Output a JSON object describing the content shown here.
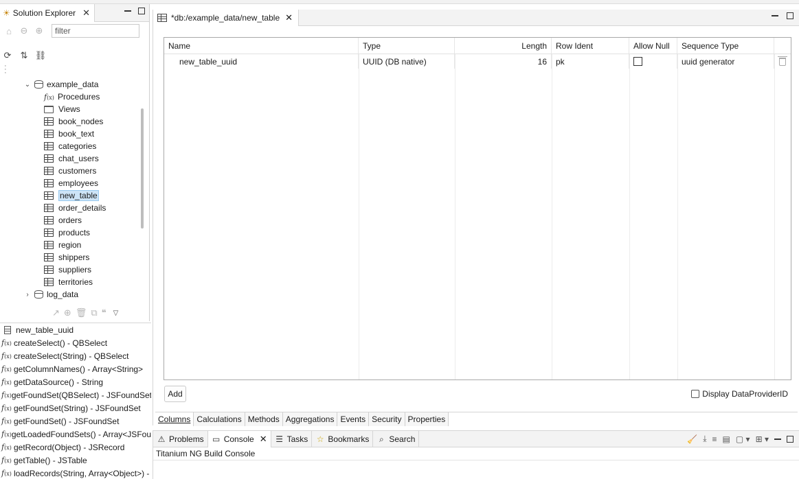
{
  "solution_explorer": {
    "tab_label": "Solution Explorer",
    "filter_placeholder": "filter",
    "tree": [
      {
        "label": "example_data",
        "kind": "db",
        "expanded": true
      },
      {
        "label": "Procedures",
        "kind": "fx"
      },
      {
        "label": "Views",
        "kind": "folder"
      },
      {
        "label": "book_nodes",
        "kind": "table"
      },
      {
        "label": "book_text",
        "kind": "table"
      },
      {
        "label": "categories",
        "kind": "table"
      },
      {
        "label": "chat_users",
        "kind": "table"
      },
      {
        "label": "customers",
        "kind": "table"
      },
      {
        "label": "employees",
        "kind": "table"
      },
      {
        "label": "new_table",
        "kind": "table",
        "selected": true
      },
      {
        "label": "order_details",
        "kind": "table"
      },
      {
        "label": "orders",
        "kind": "table"
      },
      {
        "label": "products",
        "kind": "table"
      },
      {
        "label": "region",
        "kind": "table"
      },
      {
        "label": "shippers",
        "kind": "table"
      },
      {
        "label": "suppliers",
        "kind": "table"
      },
      {
        "label": "territories",
        "kind": "table"
      },
      {
        "label": "log_data",
        "kind": "db",
        "expanded": false
      }
    ]
  },
  "methods": [
    {
      "label": "new_table_uuid",
      "kind": "column"
    },
    {
      "label": "createSelect() - QBSelect",
      "kind": "fx"
    },
    {
      "label": "createSelect(String) - QBSelect",
      "kind": "fx"
    },
    {
      "label": "getColumnNames() - Array<String>",
      "kind": "fx"
    },
    {
      "label": "getDataSource() - String",
      "kind": "fx"
    },
    {
      "label": "getFoundSet(QBSelect) - JSFoundSet",
      "kind": "fx"
    },
    {
      "label": "getFoundSet(String) - JSFoundSet",
      "kind": "fx"
    },
    {
      "label": "getFoundSet() - JSFoundSet",
      "kind": "fx"
    },
    {
      "label": "getLoadedFoundSets() - Array<JSFou",
      "kind": "fx"
    },
    {
      "label": "getRecord(Object) - JSRecord",
      "kind": "fx"
    },
    {
      "label": "getTable() - JSTable",
      "kind": "fx"
    },
    {
      "label": "loadRecords(String, Array<Object>) -",
      "kind": "fx"
    }
  ],
  "editor": {
    "tab_label": "*db:/example_data/new_table",
    "columns": [
      "Name",
      "Type",
      "Length",
      "Row Ident",
      "Allow Null",
      "Sequence Type"
    ],
    "rows": [
      {
        "name": "new_table_uuid",
        "type": "UUID (DB native)",
        "length": "16",
        "row_ident": "pk",
        "allow_null": false,
        "sequence_type": "uuid generator"
      }
    ],
    "add_label": "Add",
    "display_dp_label": "Display DataProviderID",
    "subtabs": [
      "Columns",
      "Calculations",
      "Methods",
      "Aggregations",
      "Events",
      "Security",
      "Properties"
    ]
  },
  "bottom": {
    "tabs": [
      {
        "label": "Problems",
        "icon": "warning-icon"
      },
      {
        "label": "Console",
        "icon": "console-icon",
        "active": true
      },
      {
        "label": "Tasks",
        "icon": "tasks-icon"
      },
      {
        "label": "Bookmarks",
        "icon": "bookmark-icon"
      },
      {
        "label": "Search",
        "icon": "search-icon"
      }
    ],
    "console_title": "Titanium NG Build Console"
  }
}
